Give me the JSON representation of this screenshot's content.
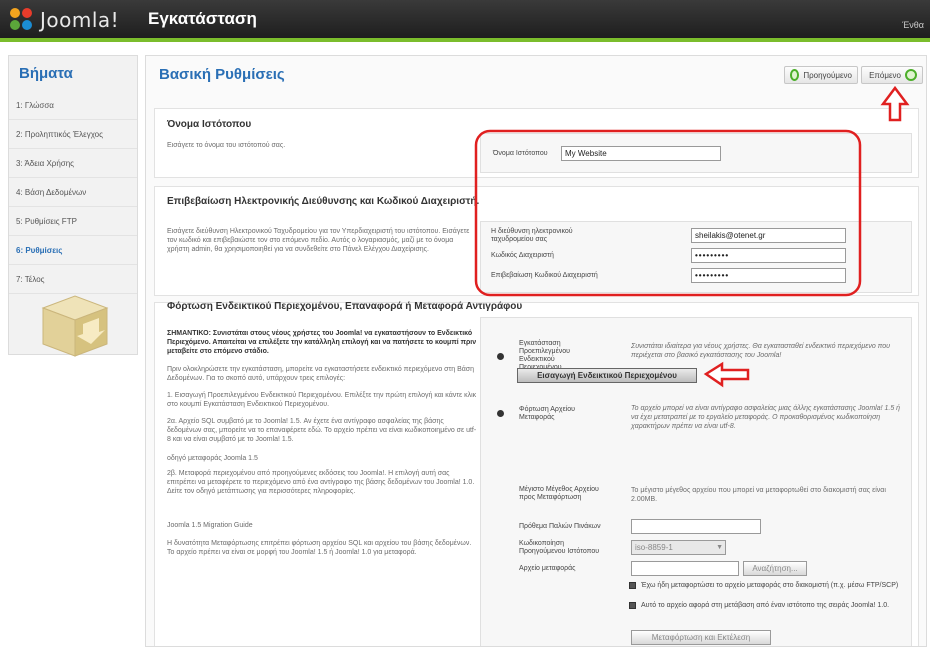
{
  "header": {
    "logo_text": "Joomla!",
    "title": "Εγκατάσταση",
    "lang": "Ένθα"
  },
  "sidebar": {
    "title": "Βήματα",
    "items": [
      {
        "label": "1: Γλώσσα",
        "active": false
      },
      {
        "label": "2: Προληπτικός Έλεγχος",
        "active": false
      },
      {
        "label": "3: Άδεια Χρήσης",
        "active": false
      },
      {
        "label": "4: Βάση Δεδομένων",
        "active": false
      },
      {
        "label": "5: Ρυθμίσεις FTP",
        "active": false
      },
      {
        "label": "6: Ρυθμίσεις",
        "active": true
      },
      {
        "label": "7: Τέλος",
        "active": false
      }
    ]
  },
  "main": {
    "title": "Βασική Ρυθμίσεις",
    "prev_label": "Προηγούμενο",
    "next_label": "Επόμενο",
    "site_name": {
      "heading": "Όνομα Ιστότοπου",
      "description": "Εισάγετε το όνομα του ιστότοπού σας.",
      "label": "Όνομα Ιστότοπου",
      "value": "My Website"
    },
    "admin": {
      "heading": "Επιβεβαίωση Ηλεκτρονικής Διεύθυνσης και Κωδικού Διαχειριστή.",
      "description": "Εισάγετε διεύθυνση Ηλεκτρονικού Ταχυδρομείου για τον Υπερδιαχειριστή του ιστότοπου. Εισάγετε τον κωδικό και επιβεβαιώστε τον στο επόμενο πεδίο. Αυτός ο λογαριασμός, μαζί με το όνομα χρήστη admin, θα χρησιμοποιηθεί για να συνδεθείτε στο Πάνελ Ελέγχου Διαχείρισης.",
      "email_label": "Η διεύθυνση ηλεκτρονικού ταχυδρομείου σας",
      "email_value": "sheilakis@otenet.gr",
      "password_label": "Κωδικός Διαχειριστή",
      "password_value": "•••••••••",
      "confirm_label": "Επιβεβαίωση Κωδικού Διαχειριστή",
      "confirm_value": "•••••••••"
    },
    "sample": {
      "heading": "Φόρτωση Ενδεικτικού Περιεχομένου, Επαναφορά ή Μεταφορά Αντιγράφου",
      "p1": "ΣΗΜΑΝΤΙΚΟ: Συνιστάται στους νέους χρήστες του Joomla! να εγκαταστήσουν το Ενδεικτικό Περιεχόμενο. Απαιτείται να επιλέξετε την κατάλληλη επιλογή και να πατήσετε το κουμπί πριν μεταβείτε στο επόμενο στάδιο.",
      "p2": "Πριν ολοκληρώσετε την εγκατάσταση, μπορείτε να εγκαταστήσετε ενδεικτικό περιεχόμενο στη Βάση Δεδομένων. Για το σκοπό αυτό, υπάρχουν τρεις επιλογές:",
      "p3": "1. Εισαγωγή Προεπιλεγμένου Ενδεικτικού Περιεχομένου. Επιλέξτε την πρώτη επιλογή και κάντε κλικ στο κουμπί Εγκατάσταση Ενδεικτικού Περιεχομένου.",
      "p4": "2α. Αρχείο SQL συμβατό με το Joomla! 1.5. Αν έχετε ένα αντίγραφο ασφαλείας της βάσης δεδομένων σας, μπορείτε να το επαναφέρετε εδώ. Το αρχείο πρέπει να είναι κωδικοποιημένο σε utf-8 και να είναι συμβατό με το Joomla! 1.5.",
      "p5": "2β. Μεταφορά περιεχομένου από προηγούμενες εκδόσεις του Joomla!. Η επιλογή αυτή σας επιτρέπει να μεταφέρετε το περιεχόμενο από ένα αντίγραφο της βάσης δεδομένων του Joomla! 1.0. Δείτε τον οδηγό μετάπτωσης για περισσότερες πληροφορίες.",
      "p6": "Η δυνατότητα Μεταφόρτωσης επιτρέπει φόρτωση αρχείου SQL και αρχείου του βάσης δεδομένων. Το αρχείο πρέπει να είναι σε μορφή του Joomla! 1.5 ή Joomla! 1.0 για μεταφορά.",
      "link1": "οδηγό μεταφοράς Joomla 1.5",
      "link2": "Joomla 1.5 Migration Guide",
      "install_label": "Εγκατάσταση Προεπιλεγμένου Ενδεικτικού Περιεχομένου",
      "install_help": "Συνιστάται ιδιαίτερα για νέους χρήστες. Θα εγκατασταθεί ενδεικτικό περιεχόμενο που περιέχεται στο βασικό εγκατάστασης του Joomla!",
      "install_button": "Εισαγωγή Ενδεικτικού Περιεχομένου",
      "load_label": "Φόρτωση Αρχείου Μεταφοράς",
      "load_help": "Το αρχείο μπορεί να είναι αντίγραφο ασφαλείας μιας άλλης εγκατάστασης Joomla! 1.5 ή να έχει μετατραπεί με το εργαλείο μεταφοράς. Ο προκαθορισμένος κωδικοποίηση χαρακτήρων πρέπει να είναι utf-8.",
      "max_size_label": "Μέγιστο Μέγεθος Αρχείου προς Μεταφόρτωση",
      "max_size_value": "Το μέγιστο μέγεθος αρχείου που μπορεί να μεταφορτωθεί στο διακομιστή σας είναι 2.00MB.",
      "prefix_label": "Πρόθεμα Παλιών Πινάκων",
      "prefix_value": "",
      "encoding_label": "Κωδικοποίηση Προηγούμενου Ιστότοπου",
      "encoding_value": "iso-8859-1",
      "file_label": "Αρχείο μεταφοράς",
      "file_value": "",
      "browse_button": "Αναζήτηση...",
      "check1_label": "Έχω ήδη μεταφορτώσει το αρχείο μεταφοράς στο διακομιστή (π.χ. μέσω FTP/SCP)",
      "check2_label": "Αυτό το αρχείο αφορά στη μετάβαση από έναν ιστότοπο της σειράς Joomla! 1.0.",
      "upload_button": "Μεταφόρτωση και Εκτέλεση"
    }
  },
  "colors": {
    "header_bg": "#2a2a2a",
    "header_accent": "#7bbd2c",
    "title_blue": "#2a6fb5",
    "annotation_red": "#e02020"
  }
}
